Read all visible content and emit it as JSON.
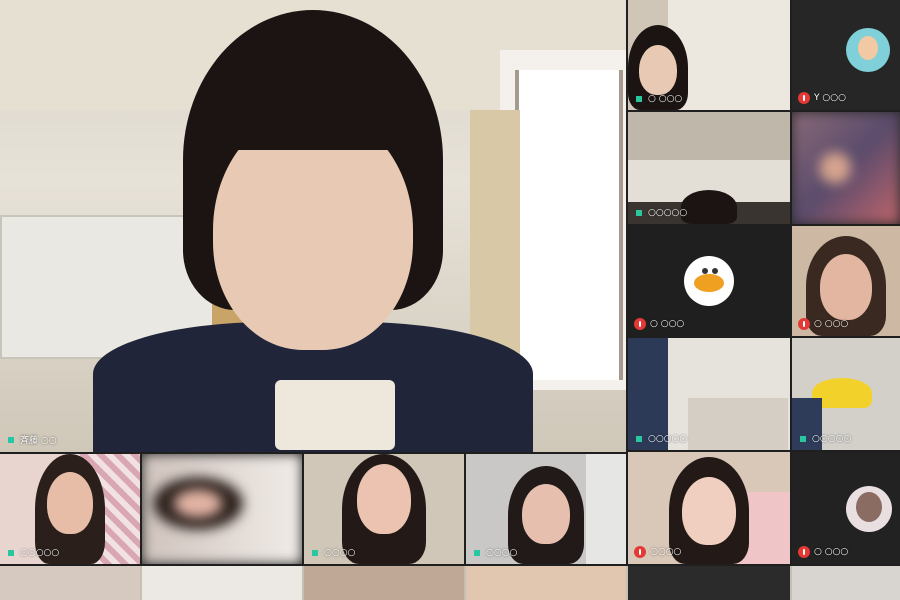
{
  "app": {
    "type": "video-conference-gallery"
  },
  "main_speaker": {
    "name": "斉藤 ○○",
    "mic": "on"
  },
  "side_tiles": [
    {
      "name": "○ ○○○",
      "mic": "on",
      "type": "video"
    },
    {
      "name": "Y ○○○",
      "mic": "off",
      "type": "avatar"
    },
    {
      "name": "○○○○○",
      "mic": "on",
      "type": "video"
    },
    {
      "name": "",
      "mic": "none",
      "type": "video-blurred"
    },
    {
      "name": "○ ○○○",
      "mic": "off",
      "type": "avatar"
    },
    {
      "name": "○ ○○○",
      "mic": "off",
      "type": "video"
    },
    {
      "name": "○○○○○",
      "mic": "on",
      "type": "video"
    },
    {
      "name": "○○○○○",
      "mic": "on",
      "type": "video"
    },
    {
      "name": "○○○○",
      "mic": "off",
      "type": "video"
    },
    {
      "name": "○ ○○○",
      "mic": "off",
      "type": "avatar"
    }
  ],
  "bottom_tiles": [
    {
      "name": "○○○○○",
      "mic": "on"
    },
    {
      "name": "",
      "mic": "none"
    },
    {
      "name": "○○○○",
      "mic": "on"
    },
    {
      "name": "○○○○",
      "mic": "on"
    }
  ],
  "colors": {
    "mic_on": "#29c7a0",
    "mic_off": "#e53935",
    "tile_bg": "#2b2b2b"
  }
}
